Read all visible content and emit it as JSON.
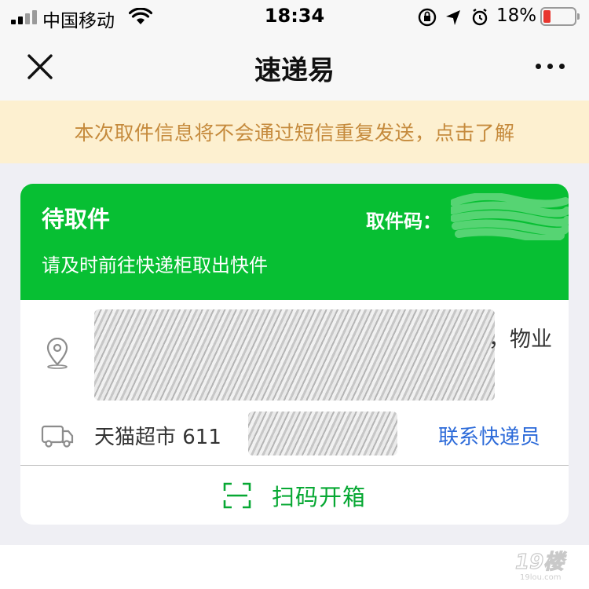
{
  "status_bar": {
    "carrier": "中国移动",
    "time": "18:34",
    "battery_percent": "18%",
    "battery_color": "#e8362f"
  },
  "nav": {
    "title": "速递易",
    "close_icon": "close-icon",
    "more_icon": "more-dots-icon"
  },
  "notice": {
    "text": "本次取件信息将不会通过短信重复发送，点击了解",
    "text_color": "#c58a3c",
    "bg_color": "#fdf0d0"
  },
  "card": {
    "accent_color": "#07bf33",
    "status_title": "待取件",
    "code_label": "取件码：",
    "status_sub": "请及时前往快递柜取出快件",
    "address_suffix": "，物业",
    "courier_text": "天猫超市  611",
    "contact_label": "联系快递员",
    "scan_label": "扫码开箱"
  },
  "watermark": {
    "text": "19楼"
  }
}
